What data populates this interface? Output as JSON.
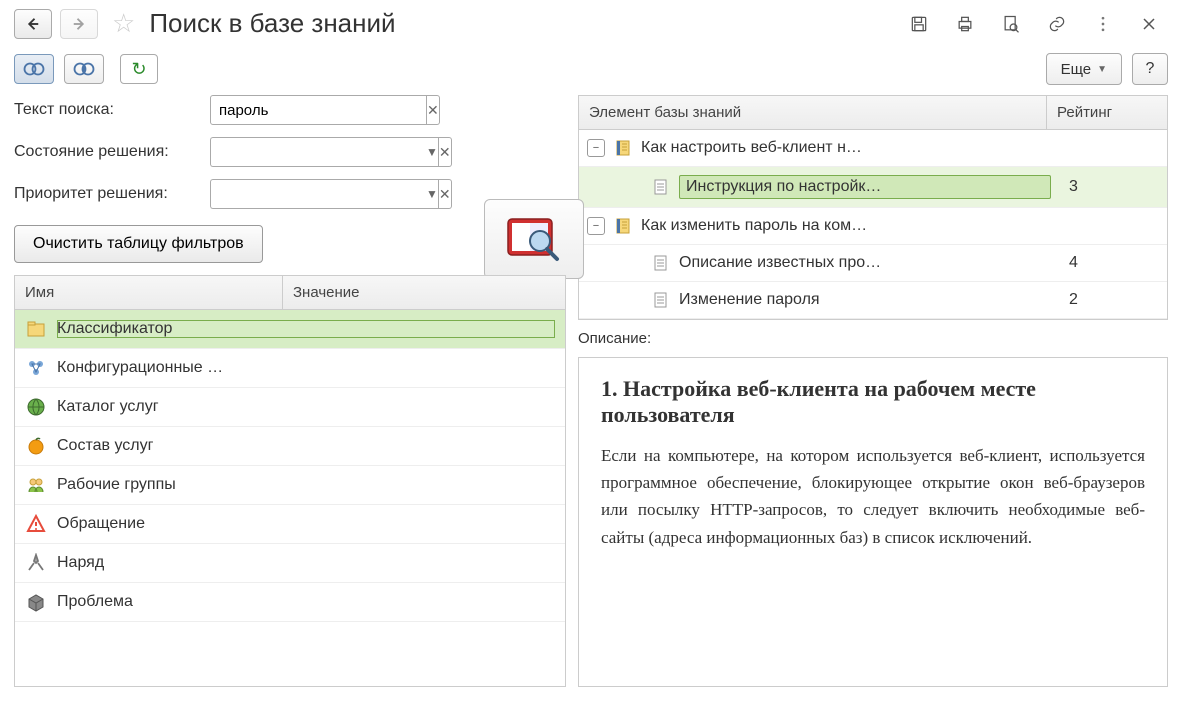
{
  "header": {
    "title": "Поиск в базе знаний"
  },
  "toolbar": {
    "more_label": "Еще",
    "help_label": "?"
  },
  "filters": {
    "text_label": "Текст поиска:",
    "text_value": "пароль",
    "state_label": "Состояние решения:",
    "state_value": "",
    "priority_label": "Приоритет решения:",
    "priority_value": "",
    "clear_label": "Очистить таблицу фильтров"
  },
  "filter_table": {
    "head_name": "Имя",
    "head_value": "Значение",
    "rows": [
      {
        "name": "Классификатор",
        "icon": "folder",
        "selected": true
      },
      {
        "name": "Конфигурационные …",
        "icon": "config"
      },
      {
        "name": "Каталог услуг",
        "icon": "globe"
      },
      {
        "name": "Состав услуг",
        "icon": "orange"
      },
      {
        "name": "Рабочие группы",
        "icon": "group"
      },
      {
        "name": "Обращение",
        "icon": "warning"
      },
      {
        "name": "Наряд",
        "icon": "wrench"
      },
      {
        "name": "Проблема",
        "icon": "box"
      }
    ]
  },
  "kb": {
    "head_element": "Элемент базы знаний",
    "head_rating": "Рейтинг",
    "rows": [
      {
        "level": 0,
        "toggle": "−",
        "icon": "notebook",
        "text": "Как настроить веб-клиент н…",
        "rating": ""
      },
      {
        "level": 1,
        "toggle": "",
        "icon": "doc",
        "text": "Инструкция по настройк…",
        "rating": "3",
        "selected": true
      },
      {
        "level": 0,
        "toggle": "−",
        "icon": "notebook",
        "text": "Как изменить пароль на ком…",
        "rating": ""
      },
      {
        "level": 1,
        "toggle": "",
        "icon": "doc",
        "text": "Описание известных про…",
        "rating": "4"
      },
      {
        "level": 1,
        "toggle": "",
        "icon": "doc",
        "text": "Изменение пароля",
        "rating": "2"
      }
    ]
  },
  "description": {
    "label": "Описание:",
    "heading": "1. Настройка веб-клиента на рабочем месте пользователя",
    "body": "Если на компьютере, на котором используется веб-клиент, используется программное обеспечение, блокирующее открытие окон веб-браузеров или посылку HTTP-запросов, то следует включить необходимые веб-сайты (адреса информационных баз) в список исключений."
  }
}
